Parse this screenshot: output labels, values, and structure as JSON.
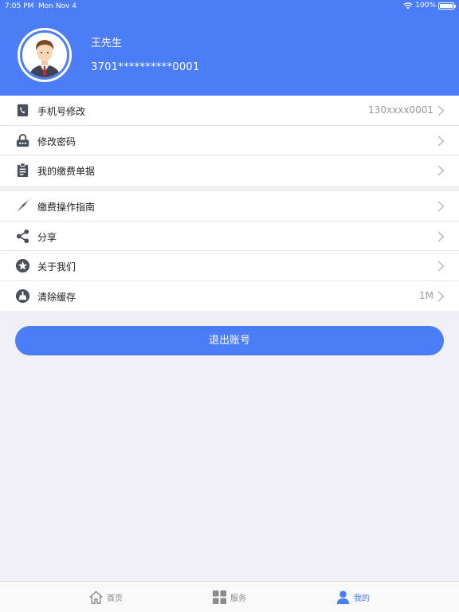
{
  "status_bar": {
    "time": "7:05 PM",
    "date": "Mon Nov 4",
    "battery": "100%"
  },
  "profile": {
    "name": "王先生",
    "id": "3701**********0001"
  },
  "section1": [
    {
      "label": "手机号修改",
      "value": "130xxxx0001",
      "icon": "phone-edit-icon"
    },
    {
      "label": "修改密码",
      "value": "",
      "icon": "lock-icon"
    },
    {
      "label": "我的缴费单据",
      "value": "",
      "icon": "clipboard-icon"
    }
  ],
  "section2": [
    {
      "label": "缴费操作指南",
      "value": "",
      "icon": "compass-icon"
    },
    {
      "label": "分享",
      "value": "",
      "icon": "share-icon"
    },
    {
      "label": "关于我们",
      "value": "",
      "icon": "star-icon"
    },
    {
      "label": "清除缓存",
      "value": "1M",
      "icon": "broom-icon"
    }
  ],
  "logout_label": "退出账号",
  "tabs": [
    {
      "label": "首页",
      "icon": "home-icon",
      "active": false
    },
    {
      "label": "服务",
      "icon": "grid-icon",
      "active": false
    },
    {
      "label": "我的",
      "icon": "person-icon",
      "active": true
    }
  ],
  "colors": {
    "primary": "#4a7df6",
    "background": "#efeff4"
  }
}
